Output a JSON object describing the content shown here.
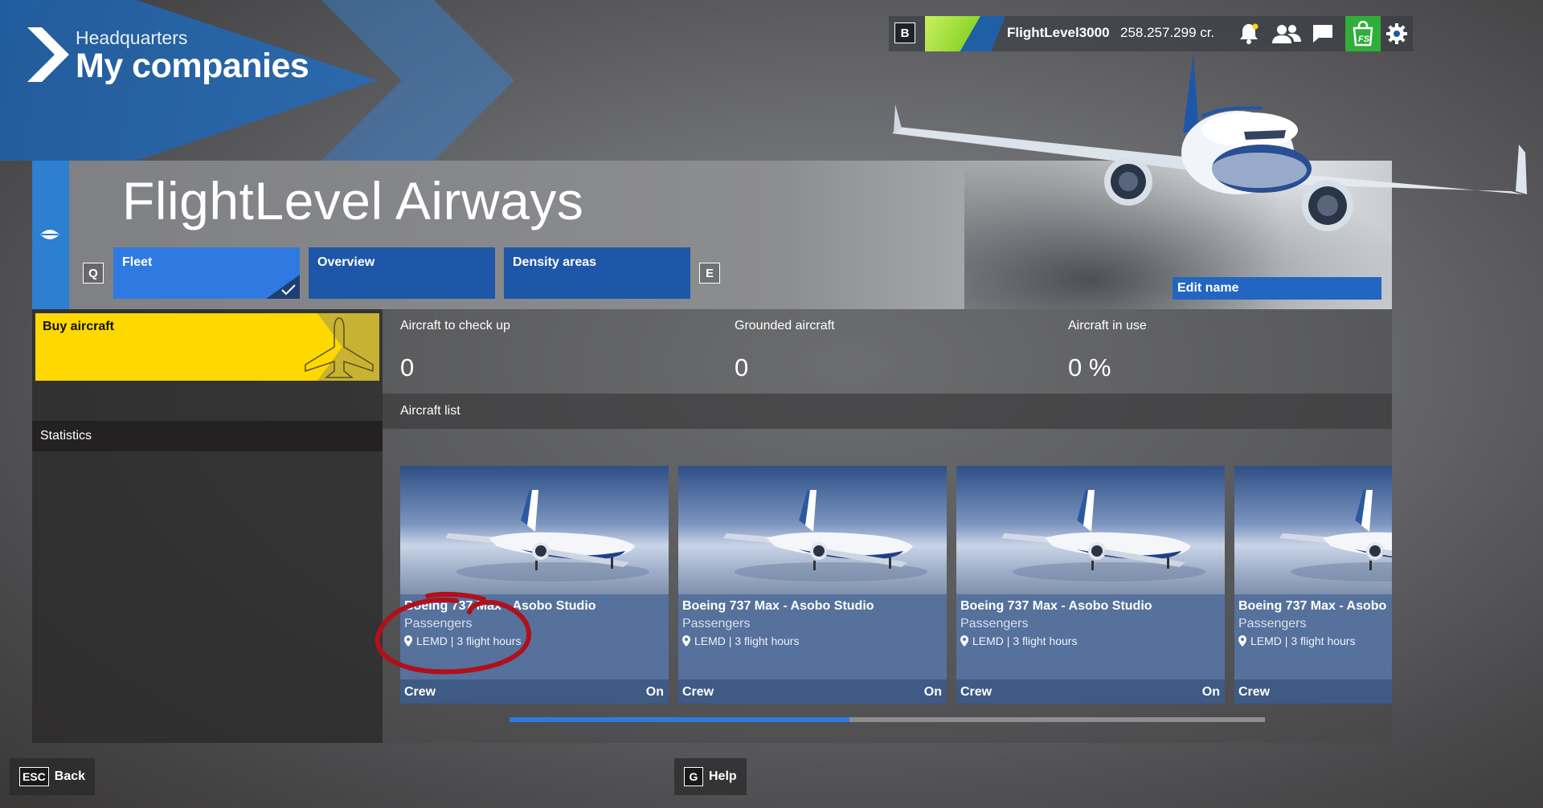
{
  "header": {
    "subtitle": "Headquarters",
    "title": "My companies"
  },
  "topbar": {
    "key": "B",
    "username": "FlightLevel3000",
    "credits": "258.257.299 cr.",
    "icons": [
      "bell-icon",
      "friends-icon",
      "chat-icon",
      "marketplace-icon",
      "gear-icon"
    ]
  },
  "company": {
    "name": "FlightLevel Airways",
    "prev_key": "Q",
    "next_key": "E",
    "tabs": [
      {
        "label": "Fleet",
        "active": true
      },
      {
        "label": "Overview",
        "active": false
      },
      {
        "label": "Density areas",
        "active": false
      }
    ],
    "edit_label": "Edit name"
  },
  "sidebar": {
    "buy_label": "Buy aircraft",
    "statistics_label": "Statistics"
  },
  "metrics": [
    {
      "label": "Aircraft to check up",
      "value": "0"
    },
    {
      "label": "Grounded aircraft",
      "value": "0"
    },
    {
      "label": "Aircraft in use",
      "value": "0 %"
    }
  ],
  "aircraft_list": {
    "title": "Aircraft list",
    "cards": [
      {
        "title": "Boeing 737 Max - Asobo Studio",
        "category": "Passengers",
        "location": "LEMD | 3 flight hours",
        "crew_label": "Crew",
        "crew_value": "On"
      },
      {
        "title": "Boeing 737 Max - Asobo Studio",
        "category": "Passengers",
        "location": "LEMD | 3 flight hours",
        "crew_label": "Crew",
        "crew_value": "On"
      },
      {
        "title": "Boeing 737 Max - Asobo Studio",
        "category": "Passengers",
        "location": "LEMD | 3 flight hours",
        "crew_label": "Crew",
        "crew_value": "On"
      },
      {
        "title": "Boeing 737 Max - Asobo",
        "category": "Passengers",
        "location": "LEMD | 3 flight hours",
        "crew_label": "Crew",
        "crew_value": ""
      }
    ],
    "scroll_progress": 0.45
  },
  "footer": {
    "back_key": "ESC",
    "back_label": "Back",
    "help_key": "G",
    "help_label": "Help"
  },
  "colors": {
    "accent": "#2f7ae0",
    "buy": "#ffd800",
    "shop": "#2fae3a",
    "annotation": "#b0101c"
  }
}
